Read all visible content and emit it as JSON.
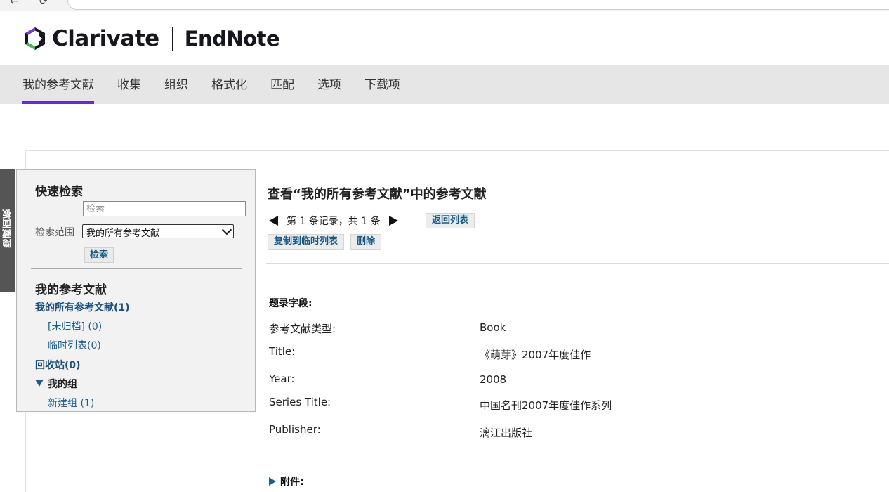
{
  "header": {
    "brand": "Clarivate",
    "product": "EndNote"
  },
  "mainnav": {
    "items": [
      "我的参考文献",
      "收集",
      "组织",
      "格式化",
      "匹配",
      "选项",
      "下载项"
    ],
    "active_index": 0
  },
  "hide_panel": {
    "label": "隐藏面板"
  },
  "quick_search": {
    "title": "快速检索",
    "placeholder": "检索",
    "scope_label": "检索范围",
    "scope_value": "我的所有参考文献",
    "search_button": "检索"
  },
  "my_references": {
    "title": "我的参考文献",
    "all": "我的所有参考文献(1)",
    "unfiled": "[未归档] (0)",
    "quick_list": "临时列表(0)",
    "trash": "回收站(0)",
    "my_groups": "我的组",
    "new_group": "新建组 (1)"
  },
  "record_view": {
    "title": "查看“我的所有参考文献”中的参考文献",
    "pager_text": "第 1 条记录，共 1 条",
    "back_to_list": "返回列表",
    "copy_to_quick_list": "复制到临时列表",
    "delete": "删除",
    "section_title": "题录字段:",
    "fields": [
      {
        "label": "参考文献类型:",
        "value": "Book"
      },
      {
        "label": "Title:",
        "value": "《萌芽》2007年度佳作"
      },
      {
        "label": "Year:",
        "value": "2008"
      },
      {
        "label": "Series Title:",
        "value": "中国名刊2007年度佳作系列"
      },
      {
        "label": "Publisher:",
        "value": "漓江出版社"
      }
    ],
    "attachments_label": "附件:"
  },
  "colors": {
    "nav_active_underline": "#5e33bf",
    "link_blue": "#1d5d8c",
    "nav_bg": "#e6e6e6"
  }
}
